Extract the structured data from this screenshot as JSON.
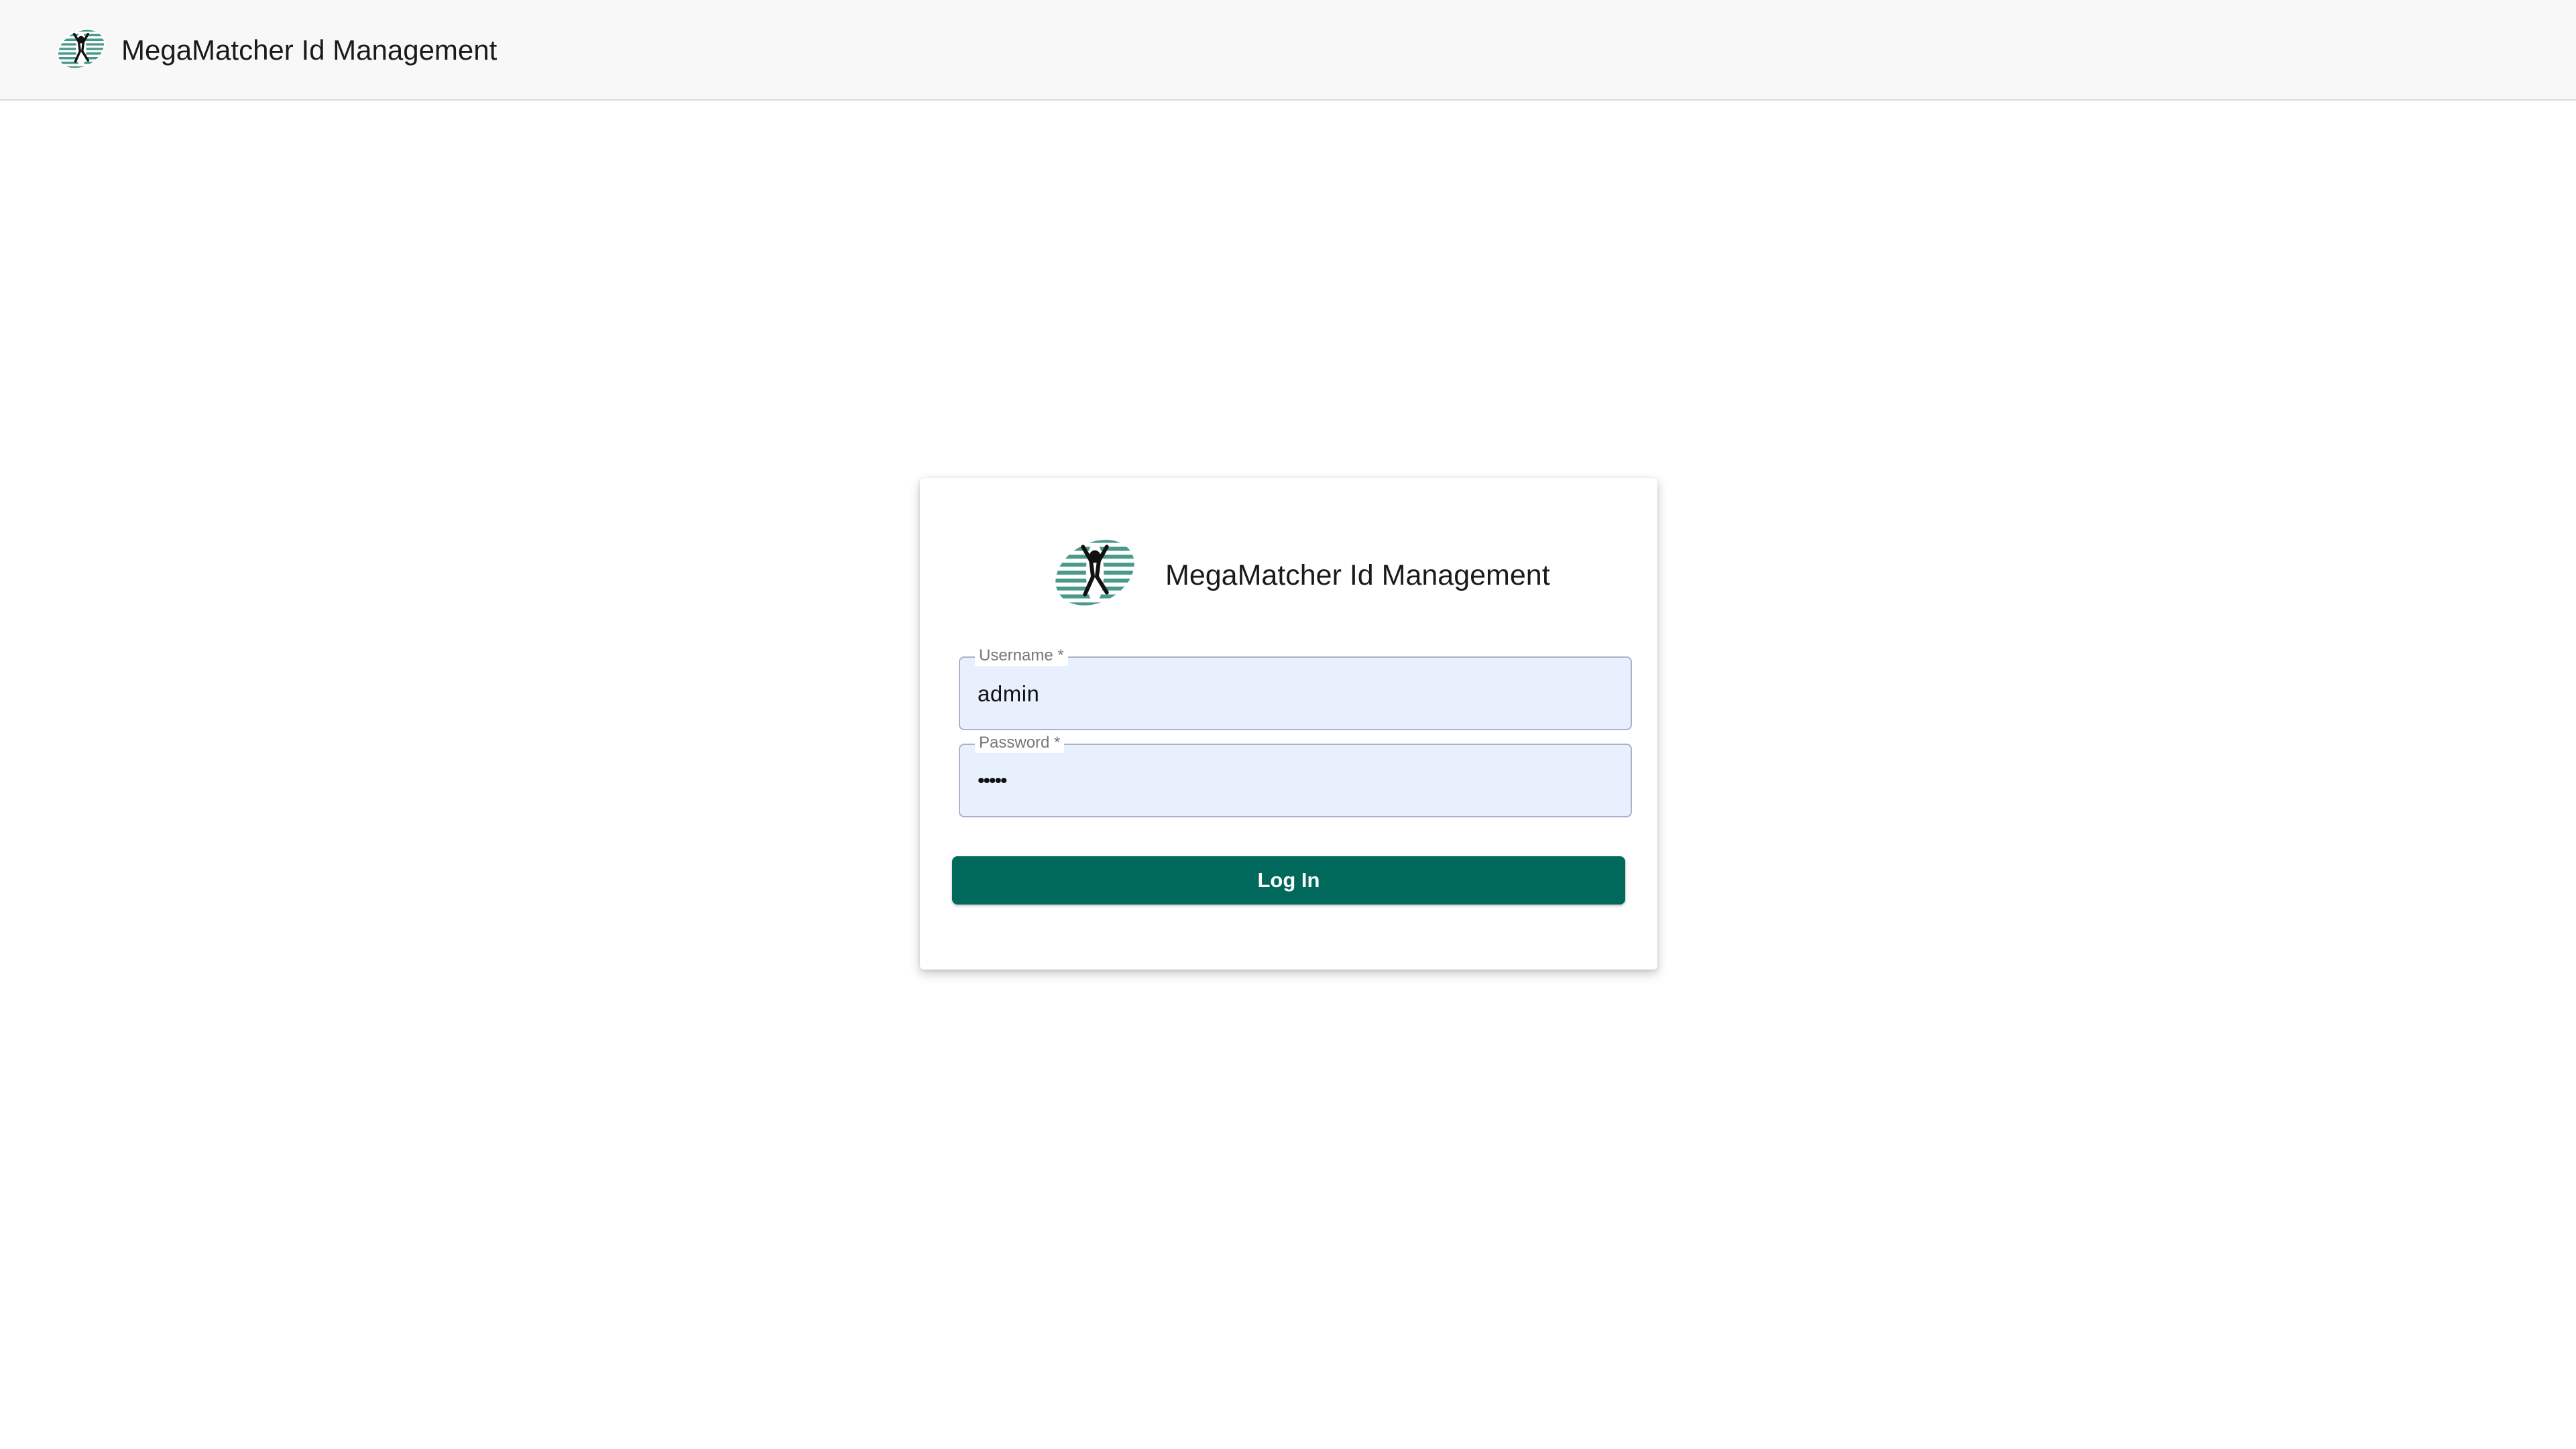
{
  "header": {
    "app_title": "MegaMatcher Id Management",
    "logo_icon": "megamatcher-logo-icon"
  },
  "login_card": {
    "logo_icon": "megamatcher-logo-icon",
    "title": "MegaMatcher Id Management",
    "username": {
      "label": "Username *",
      "value": "admin"
    },
    "password": {
      "label": "Password *",
      "value": "•••••"
    },
    "login_button_label": "Log In"
  },
  "colors": {
    "primary": "#00695c",
    "autofill_background": "#e8f0fe",
    "header_background": "#f8f8f8"
  }
}
